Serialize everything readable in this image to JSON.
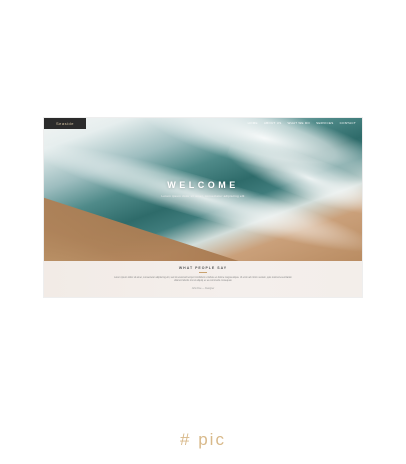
{
  "site": {
    "logo_text": "Seaside",
    "nav": [
      "HOME",
      "ABOUT US",
      "WHAT WE DO",
      "SERVICES",
      "CONTACT"
    ],
    "hero_title": "WELCOME",
    "hero_subtitle": "Lorem ipsum dolor sit amet, consectetur adipiscing elit",
    "testimonials_title": "WHAT PEOPLE SAY",
    "testimonial_text": "Lorem ipsum dolor sit amet, consectetur adipiscing elit, sed do eiusmod tempor incididunt ut labore et dolore magna aliqua. Ut enim ad minim veniam, quis nostrud exercitation ullamco laboris nisi ut aliquip ex ea commodo consequat.",
    "testimonial_author": "John Doe — Designer"
  },
  "caption": "# pic",
  "colors": {
    "accent": "#d8b98a",
    "logo_bg": "#2b2b2b"
  }
}
